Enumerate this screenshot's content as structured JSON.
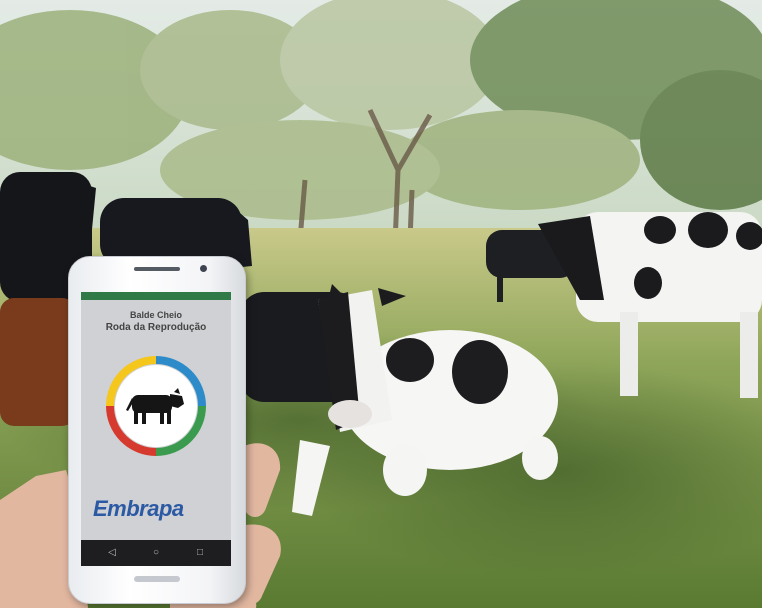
{
  "app": {
    "title_line1": "Balde Cheio",
    "title_line2": "Roda da Reprodução",
    "logo_text": "Embrapa"
  },
  "ring_colors": [
    "#2e8bc9",
    "#f5c61c",
    "#3a9b4e",
    "#d63a2e"
  ],
  "statusbar_color": "#2f7a46",
  "icons": {
    "cow": "cow-icon",
    "back": "back-icon",
    "home": "home-icon",
    "recent": "recent-apps-icon"
  }
}
